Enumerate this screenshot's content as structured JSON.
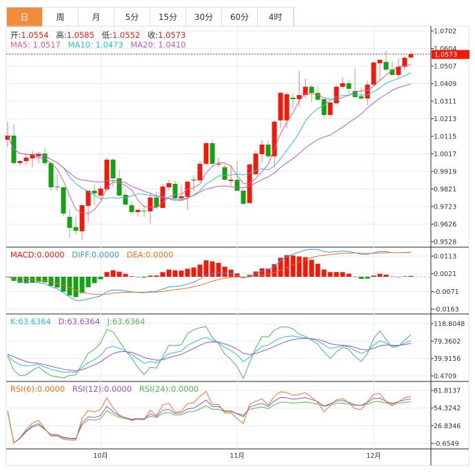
{
  "tabs": [
    "日",
    "周",
    "月",
    "5分",
    "15分",
    "30分",
    "60分",
    "4时"
  ],
  "active_tab": 0,
  "legend": {
    "open_label": "开:",
    "open": "1.0554",
    "high_label": "高:",
    "high": "1.0585",
    "low_label": "低:",
    "low": "1.0552",
    "close_label": "收:",
    "close": "1.0573",
    "ma5": "MA5: 1.0517",
    "ma10": "MA10: 1.0473",
    "ma20": "MA20: 1.0410"
  },
  "macd_legend": {
    "macd": "MACD:0.0000",
    "diff": "DIFF:0.0000",
    "dea": "DEA:0.0000"
  },
  "kdj_legend": {
    "k": "K:63.6364",
    "d": "D:63.6364",
    "j": "J:63.6364"
  },
  "rsi_legend": {
    "rsi6": "RSI(6):0.0000",
    "rsi12": "RSI(12):0.0000",
    "rsi24": "RSI(24):0.0000"
  },
  "current_price": "1.0573",
  "colors": {
    "up": "#f01a0a",
    "down": "#16a016",
    "ma5": "#e8588a",
    "ma10": "#28c0d8",
    "ma20": "#b05ccb",
    "diff": "#3a9be0",
    "dea": "#f07020",
    "k": "#28c0d8",
    "d": "#9a4fd0",
    "j": "#4cb84c",
    "rsi6": "#f07020",
    "rsi12": "#9a4fd0",
    "rsi24": "#4cb84c",
    "tab_active": "#f08c3c"
  },
  "chart_data": {
    "type": "candlestick",
    "x_tick_labels": [
      "10月",
      "11月",
      "12月"
    ],
    "x_tick_index": [
      15,
      37,
      59
    ],
    "price_axis": {
      "ticks": [
        "1.0702",
        "1.0604",
        "1.0507",
        "1.0409",
        "1.0311",
        "1.0213",
        "1.0115",
        "1.0017",
        "0.9919",
        "0.9821",
        "0.9723",
        "0.9626",
        "0.9528"
      ],
      "ylim": [
        0.9528,
        1.0702
      ]
    },
    "macd_axis": {
      "ticks": [
        "0.0113",
        "0.0021",
        "-0.0071",
        "-0.0163"
      ]
    },
    "kdj_axis": {
      "ticks": [
        "118.8048",
        "79.3602",
        "39.9156",
        "0.4709"
      ],
      "ylim": [
        0.4709,
        118.8048
      ]
    },
    "rsi_axis": {
      "ticks": [
        "81.8137",
        "54.3242",
        "26.8346",
        "-0.6549"
      ],
      "ylim": [
        -0.6549,
        81.8137
      ]
    },
    "ohlc": [
      [
        1.0096,
        1.0196,
        1.0057,
        1.0119
      ],
      [
        1.0119,
        1.0184,
        0.9954,
        0.9966
      ],
      [
        0.9966,
        0.9985,
        0.9954,
        0.9977
      ],
      [
        0.9977,
        1.0019,
        0.9954,
        0.9996
      ],
      [
        0.9992,
        1.0035,
        0.9943,
        1.0012
      ],
      [
        1.0004,
        1.0027,
        0.9966,
        1.0019
      ],
      [
        1.0019,
        1.005,
        0.9954,
        0.9966
      ],
      [
        0.9966,
        0.9973,
        0.9812,
        0.9831
      ],
      [
        0.9835,
        0.9904,
        0.9808,
        0.9831
      ],
      [
        0.9831,
        0.9835,
        0.967,
        0.9685
      ],
      [
        0.9666,
        0.9709,
        0.9551,
        0.9605
      ],
      [
        0.9609,
        0.967,
        0.9566,
        0.9589
      ],
      [
        0.9586,
        0.9735,
        0.9536,
        0.9731
      ],
      [
        0.9728,
        0.9816,
        0.9636,
        0.9812
      ],
      [
        0.9812,
        0.985,
        0.9731,
        0.9797
      ],
      [
        0.9785,
        0.9843,
        0.9762,
        0.9824
      ],
      [
        0.982,
        0.9996,
        0.9808,
        0.9985
      ],
      [
        0.9985,
        0.9992,
        0.9835,
        0.9881
      ],
      [
        0.9881,
        0.9927,
        0.9778,
        0.9785
      ],
      [
        0.9789,
        0.9816,
        0.9724,
        0.9735
      ],
      [
        0.9731,
        0.975,
        0.9682,
        0.9693
      ],
      [
        0.9693,
        0.9709,
        0.967,
        0.9705
      ],
      [
        0.9701,
        0.9731,
        0.9666,
        0.9697
      ],
      [
        0.9697,
        0.9801,
        0.9628,
        0.9774
      ],
      [
        0.9774,
        0.9808,
        0.9709,
        0.972
      ],
      [
        0.9716,
        0.985,
        0.9716,
        0.9835
      ],
      [
        0.9831,
        0.9873,
        0.9812,
        0.9854
      ],
      [
        0.985,
        0.987,
        0.9766,
        0.977
      ],
      [
        0.977,
        0.9843,
        0.9754,
        0.9781
      ],
      [
        0.9778,
        0.987,
        0.9705,
        0.9862
      ],
      [
        0.987,
        0.9897,
        0.9808,
        0.9873
      ],
      [
        0.987,
        0.9977,
        0.9862,
        0.9962
      ],
      [
        0.9962,
        1.0088,
        0.9954,
        1.0077
      ],
      [
        1.0077,
        1.0092,
        0.9946,
        0.9962
      ],
      [
        0.9958,
        0.9996,
        0.9943,
        0.9962
      ],
      [
        0.9943,
        0.9962,
        0.987,
        0.9873
      ],
      [
        0.9866,
        0.9954,
        0.9839,
        0.9873
      ],
      [
        0.9873,
        0.9977,
        0.9808,
        0.9812
      ],
      [
        0.9812,
        0.982,
        0.9731,
        0.9739
      ],
      [
        0.9743,
        0.9966,
        0.9739,
        0.9958
      ],
      [
        0.9904,
        1.0035,
        0.9897,
        1.0019
      ],
      [
        1.0015,
        1.0096,
        0.9969,
        1.0069
      ],
      [
        1.0069,
        1.0088,
        0.9992,
        1.0004
      ],
      [
        1.0004,
        1.0204,
        0.9939,
        1.0196
      ],
      [
        1.0204,
        1.0365,
        1.0161,
        1.0357
      ],
      [
        1.0204,
        1.0361,
        1.0161,
        1.0349
      ],
      [
        1.033,
        1.0357,
        1.0269,
        1.0322
      ],
      [
        1.0322,
        1.048,
        1.028,
        1.0345
      ],
      [
        1.0345,
        1.0437,
        1.0326,
        1.0391
      ],
      [
        1.0391,
        1.0403,
        1.0303,
        1.0357
      ],
      [
        1.0357,
        1.0395,
        1.0315,
        1.0319
      ],
      [
        1.0322,
        1.0326,
        1.0219,
        1.0234
      ],
      [
        1.0234,
        1.0307,
        1.023,
        1.0303
      ],
      [
        1.0299,
        1.0403,
        1.0296,
        1.0391
      ],
      [
        1.0391,
        1.0445,
        1.038,
        1.0411
      ],
      [
        1.0411,
        1.043,
        1.0353,
        1.038
      ],
      [
        1.0368,
        1.0495,
        1.0326,
        1.0334
      ],
      [
        1.0338,
        1.0388,
        1.0319,
        1.0326
      ],
      [
        1.0326,
        1.0426,
        1.0288,
        1.0403
      ],
      [
        1.0403,
        1.0533,
        1.0395,
        1.0526
      ],
      [
        1.0522,
        1.0545,
        1.0426,
        1.0541
      ],
      [
        1.053,
        1.0595,
        1.048,
        1.0487
      ],
      [
        1.0487,
        1.0533,
        1.0457,
        1.0457
      ],
      [
        1.0457,
        1.0549,
        1.0441,
        1.0503
      ],
      [
        1.0503,
        1.056,
        1.0487,
        1.0553
      ],
      [
        1.0554,
        1.0585,
        1.0552,
        1.0573
      ]
    ]
  }
}
